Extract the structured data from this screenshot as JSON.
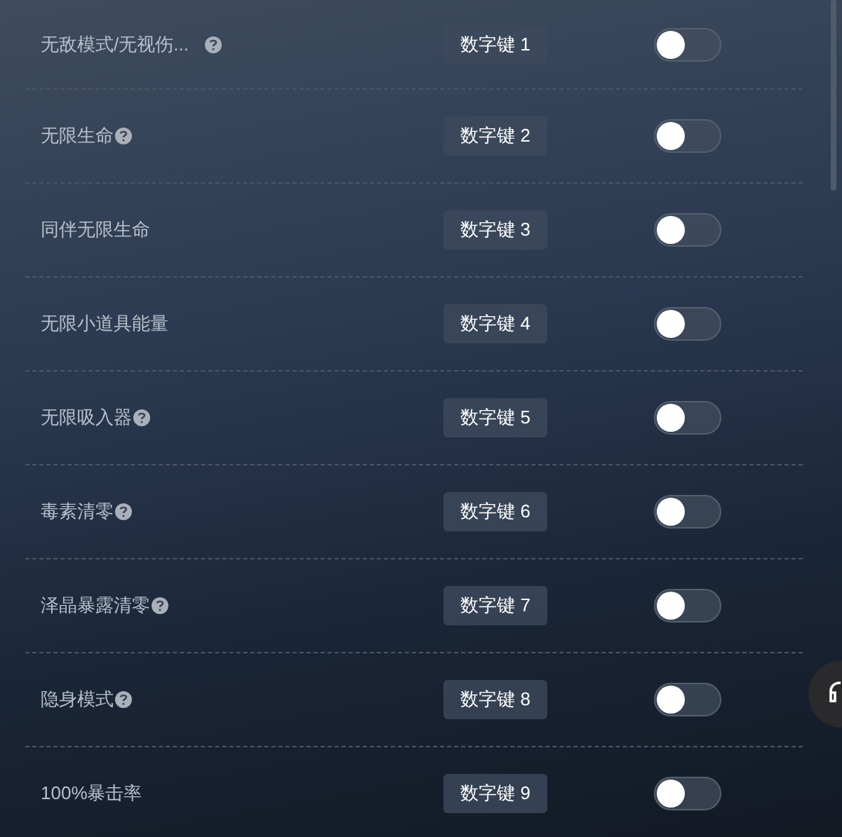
{
  "options": [
    {
      "label": "无敌模式/无视伤...",
      "help": true,
      "hotkey": "数字键 1",
      "on": false
    },
    {
      "label": "无限生命",
      "help": true,
      "hotkey": "数字键 2",
      "on": false
    },
    {
      "label": "同伴无限生命",
      "help": false,
      "hotkey": "数字键 3",
      "on": false
    },
    {
      "label": "无限小道具能量",
      "help": false,
      "hotkey": "数字键 4",
      "on": false
    },
    {
      "label": "无限吸入器",
      "help": true,
      "hotkey": "数字键 5",
      "on": false
    },
    {
      "label": "毒素清零",
      "help": true,
      "hotkey": "数字键 6",
      "on": false
    },
    {
      "label": "泽晶暴露清零",
      "help": true,
      "hotkey": "数字键 7",
      "on": false
    },
    {
      "label": "隐身模式",
      "help": true,
      "hotkey": "数字键 8",
      "on": false
    },
    {
      "label": "100%暴击率",
      "help": false,
      "hotkey": "数字键 9",
      "on": false
    }
  ]
}
